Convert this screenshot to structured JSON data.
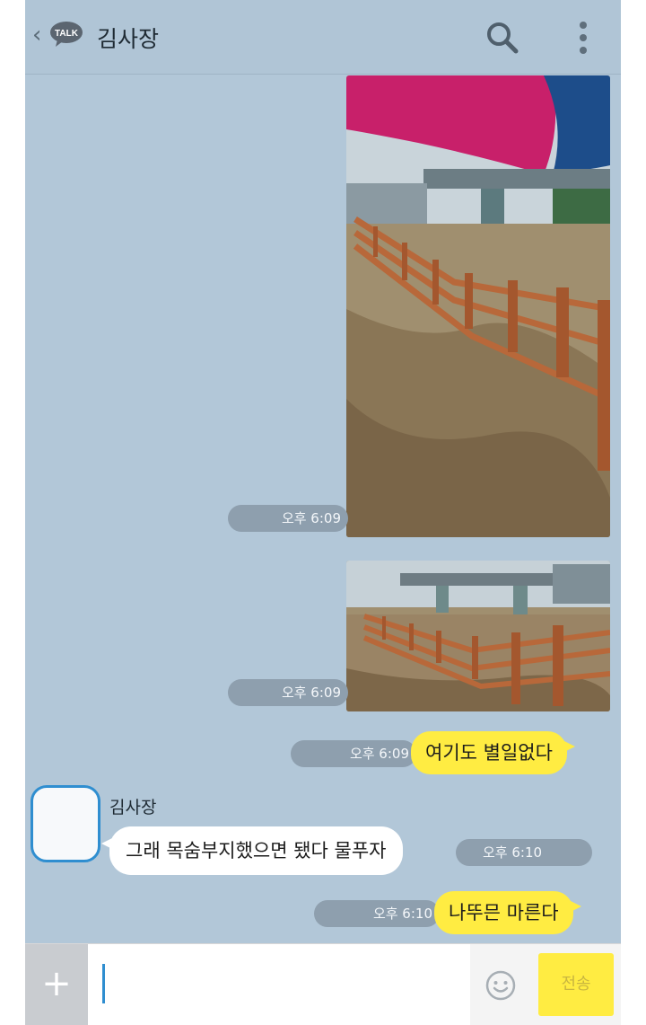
{
  "header": {
    "app_badge": "TALK",
    "title": "김사장"
  },
  "messages": {
    "photo1_time": "오후 6:09",
    "photo2_time": "오후 6:09",
    "msg1": {
      "text": "여기도 별일없다",
      "time": "오후 6:09"
    },
    "sender_name": "김사장",
    "msg2": {
      "text": "그래 목숨부지했으면 됐다 물푸자",
      "time": "오후 6:10"
    },
    "msg3": {
      "text": "나뚜믄 마른다",
      "time": "오후 6:10"
    }
  },
  "input": {
    "placeholder": "",
    "send_label": "전송"
  },
  "colors": {
    "chat_bg": "#b2c7d8",
    "my_bubble": "#ffec42",
    "their_bubble": "#ffffff",
    "time_pill": "#8e9fae"
  },
  "icons": [
    "back-chevron-icon",
    "talk-icon",
    "search-icon",
    "more-vertical-icon",
    "plus-icon",
    "emoji-icon"
  ]
}
